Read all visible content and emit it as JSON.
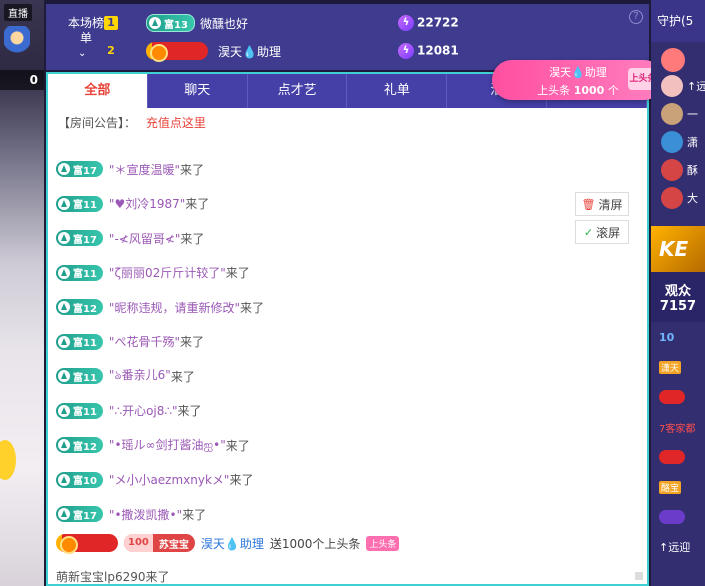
{
  "video": {
    "tag": "直播",
    "count": "0"
  },
  "leaderboard": {
    "label": "本场榜单",
    "rows": [
      {
        "rank": "1",
        "badge": "富13",
        "name": "微醺也好",
        "value": "22722"
      },
      {
        "rank": "2",
        "badge": "",
        "name": "淏天💧助理",
        "value": "12081"
      }
    ],
    "help": "?"
  },
  "tabs": [
    {
      "label": "全部",
      "active": true
    },
    {
      "label": "聊天",
      "active": false
    },
    {
      "label": "点才艺",
      "active": false
    },
    {
      "label": "礼单",
      "active": false
    },
    {
      "label": "活",
      "active": false
    },
    {
      "label": "",
      "active": false
    }
  ],
  "announcement": {
    "label": "【房间公告】：",
    "link": "充值点这里"
  },
  "headline_popup": {
    "line1": "淏天💧助理",
    "line2_prefix": "上头条",
    "line2_count": "1000",
    "line2_suffix": "个",
    "badge": "上头条"
  },
  "messages": [
    {
      "badge": "富17",
      "nick": "\"＊宣度温暖\"",
      "suffix": "来了"
    },
    {
      "badge": "富11",
      "nick": "\"♥刘冷1987\"",
      "suffix": "来了"
    },
    {
      "badge": "富17",
      "nick": "\"-≮风留哥≮\"",
      "suffix": "来了"
    },
    {
      "badge": "富11",
      "nick": "\"ζ丽丽02斤斤计较了\"",
      "suffix": "来了"
    },
    {
      "badge": "富12",
      "nick": "\"昵称违规，请重新修改\"",
      "suffix": "来了"
    },
    {
      "badge": "富11",
      "nick": "\"ぺ花骨千殇\"",
      "suffix": "来了"
    },
    {
      "badge": "富11",
      "nick": "\"ঌ番亲儿6\"",
      "suffix": "来了"
    },
    {
      "badge": "富11",
      "nick": "\"∴开心oj8∴\"",
      "suffix": "来了"
    },
    {
      "badge": "富12",
      "nick": "\"•瑶ル∞剑打酱油ஐ•\"",
      "suffix": "来了"
    },
    {
      "badge": "富10",
      "nick": "\"メ小小aezmxnykメ\"",
      "suffix": "来了"
    },
    {
      "badge": "富17",
      "nick": "\"•撒泼凯撒•\"",
      "suffix": "来了"
    }
  ],
  "side_buttons": {
    "clear": "清屏",
    "scroll": "滚屏"
  },
  "gift_line": {
    "su_num": "100",
    "su_text": "苏宝宝",
    "name": "淏天💧助理",
    "text": "送1000个上头条",
    "tag": "上头条"
  },
  "last_line": "萌新宝宝lp6290来了",
  "right": {
    "guard": "守护(5",
    "rows": [
      "↑远",
      "一",
      "潇",
      "酥",
      "大"
    ],
    "banner": "KE",
    "audience_label": "观众",
    "audience_count": "7157",
    "aud_rows": [
      "10",
      "潇天",
      "",
      "7客家都",
      "",
      "酪宝",
      "",
      "↑远迎"
    ]
  },
  "colors": {
    "accent": "#e8433a",
    "tab_bg": "#4440a8",
    "border": "#3fd0d4",
    "badge": "#1f9e8c"
  }
}
